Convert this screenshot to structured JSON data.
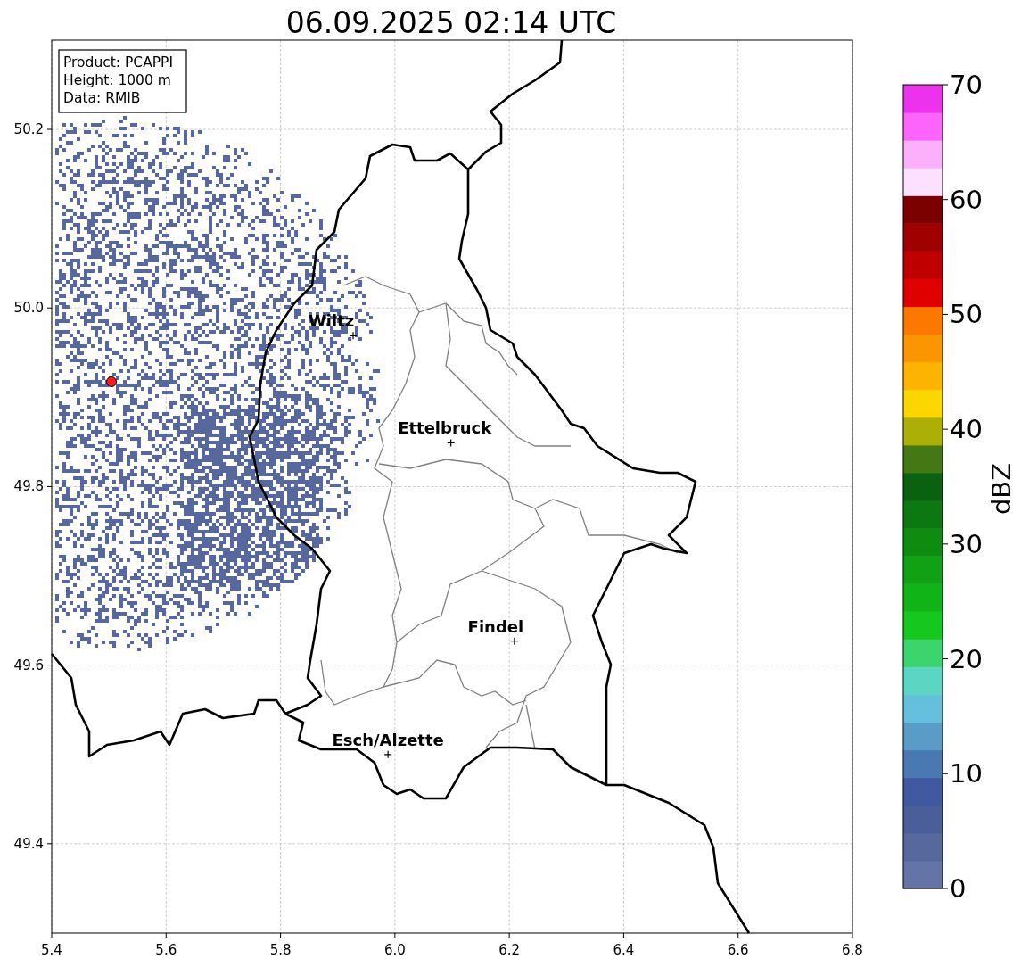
{
  "title": "06.09.2025 02:14 UTC",
  "info_box": [
    "Product: PCAPPI",
    "Height: 1000 m",
    "Data: RMIB"
  ],
  "x_ticks": [
    "5.4",
    "5.6",
    "5.8",
    "6.0",
    "6.2",
    "6.4",
    "6.6",
    "6.8"
  ],
  "y_ticks": [
    "50.2",
    "50.0",
    "49.8",
    "49.6",
    "49.4"
  ],
  "cities": [
    {
      "name": "Wiltz"
    },
    {
      "name": "Ettelbruck"
    },
    {
      "name": "Findel"
    },
    {
      "name": "Esch/Alzette"
    }
  ],
  "colorbar": {
    "label": "dBZ",
    "ticks": [
      "70",
      "60",
      "50",
      "40",
      "30",
      "20",
      "10",
      "0"
    ]
  }
}
